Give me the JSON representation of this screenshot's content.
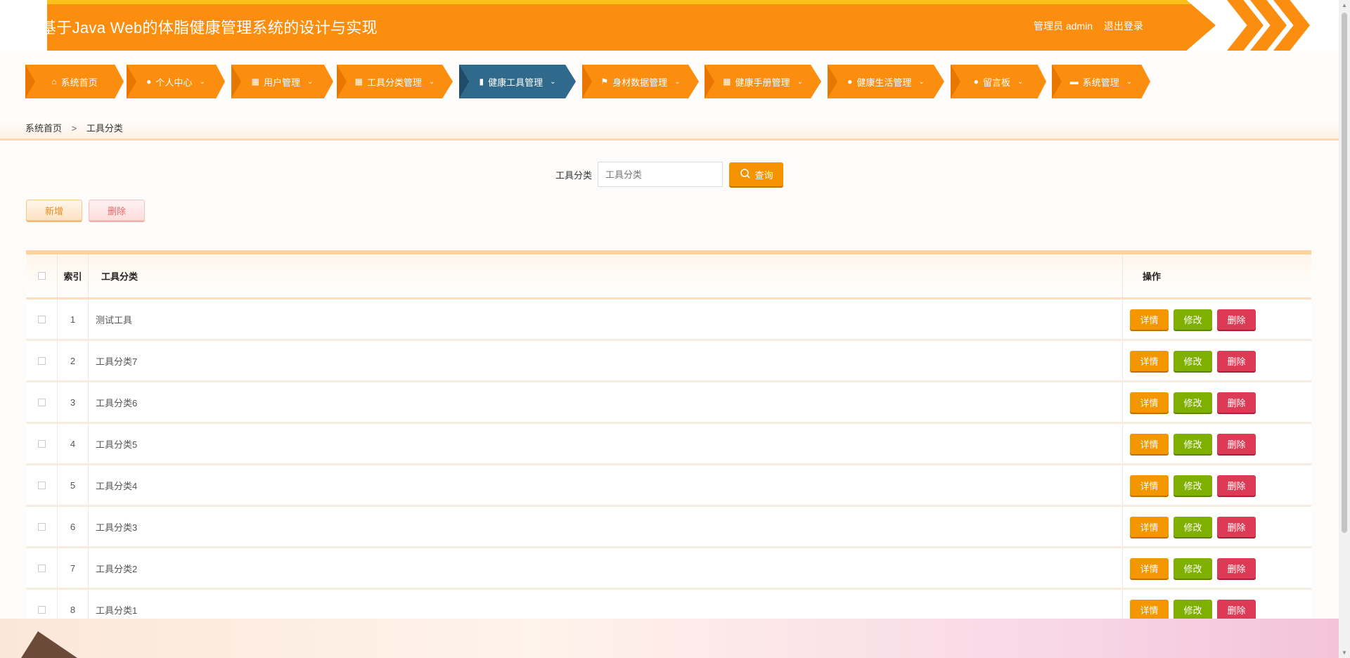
{
  "header": {
    "title": "基于Java Web的体脂健康管理系统的设计与实现",
    "user_role": "管理员 admin",
    "logout": "退出登录"
  },
  "nav": {
    "items": [
      {
        "label": "系统首页",
        "icon": "home-icon",
        "has_dropdown": false,
        "active": false
      },
      {
        "label": "个人中心",
        "icon": "user-icon",
        "has_dropdown": true,
        "active": false
      },
      {
        "label": "用户管理",
        "icon": "grid-icon",
        "has_dropdown": true,
        "active": false
      },
      {
        "label": "工具分类管理",
        "icon": "grid-icon",
        "has_dropdown": true,
        "active": false
      },
      {
        "label": "健康工具管理",
        "icon": "chart-icon",
        "has_dropdown": true,
        "active": true
      },
      {
        "label": "身材数据管理",
        "icon": "flag-icon",
        "has_dropdown": true,
        "active": false
      },
      {
        "label": "健康手册管理",
        "icon": "grid-icon",
        "has_dropdown": true,
        "active": false
      },
      {
        "label": "健康生活管理",
        "icon": "user-icon",
        "has_dropdown": true,
        "active": false
      },
      {
        "label": "留言板",
        "icon": "bulb-icon",
        "has_dropdown": true,
        "active": false
      },
      {
        "label": "系统管理",
        "icon": "print-icon",
        "has_dropdown": true,
        "active": false
      }
    ]
  },
  "breadcrumb": {
    "home": "系统首页",
    "separator": ">",
    "current": "工具分类"
  },
  "search": {
    "label": "工具分类",
    "placeholder": "工具分类",
    "button": "查询"
  },
  "actions": {
    "add": "新增",
    "delete": "删除"
  },
  "table": {
    "columns": {
      "index": "索引",
      "name": "工具分类",
      "ops": "操作"
    },
    "rows": [
      {
        "index": "1",
        "name": "测试工具"
      },
      {
        "index": "2",
        "name": "工具分类7"
      },
      {
        "index": "3",
        "name": "工具分类6"
      },
      {
        "index": "4",
        "name": "工具分类5"
      },
      {
        "index": "5",
        "name": "工具分类4"
      },
      {
        "index": "6",
        "name": "工具分类3"
      },
      {
        "index": "7",
        "name": "工具分类2"
      },
      {
        "index": "8",
        "name": "工具分类1"
      }
    ],
    "row_buttons": {
      "detail": "详情",
      "edit": "修改",
      "delete": "删除"
    }
  },
  "colors": {
    "primary": "#fb8e0e",
    "active_nav": "#2f6a8c",
    "detail": "#f39600",
    "edit": "#7fb000",
    "delete": "#dd3b55"
  }
}
